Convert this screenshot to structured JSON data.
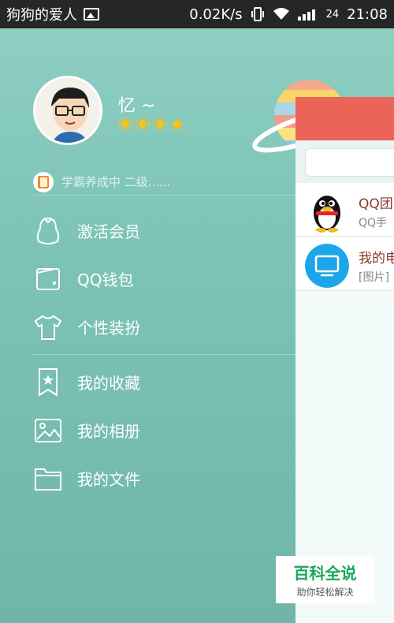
{
  "status_bar": {
    "carrier": "狗狗的爱人",
    "speed": "0.02K/s",
    "network_tag": "24",
    "time": "21:08"
  },
  "profile": {
    "name": "忆 ~",
    "level_icons": [
      "sun-icon",
      "sun-icon",
      "sun-icon",
      "star-icon"
    ],
    "signature": "学霸养成中 二级......"
  },
  "menu": {
    "items": [
      {
        "label": "激活会员",
        "icon": "penguin-outline-icon"
      },
      {
        "label": "QQ钱包",
        "icon": "wallet-icon"
      },
      {
        "label": "个性装扮",
        "icon": "tshirt-icon"
      },
      {
        "label": "我的收藏",
        "icon": "bookmark-star-icon"
      },
      {
        "label": "我的相册",
        "icon": "photo-icon"
      },
      {
        "label": "我的文件",
        "icon": "folder-icon"
      }
    ]
  },
  "conversations": [
    {
      "title": "QQ团",
      "subtitle": "QQ手",
      "icon": "qq-penguin-icon"
    },
    {
      "title": "我的电",
      "subtitle": "[图片]",
      "icon": "computer-icon"
    }
  ],
  "watermark": {
    "title": "百科全说",
    "subtitle": "助你轻松解决"
  },
  "colors": {
    "drawer_bg": "#7dc3b6",
    "header_red": "#ea6457",
    "status_bar": "#262626"
  }
}
